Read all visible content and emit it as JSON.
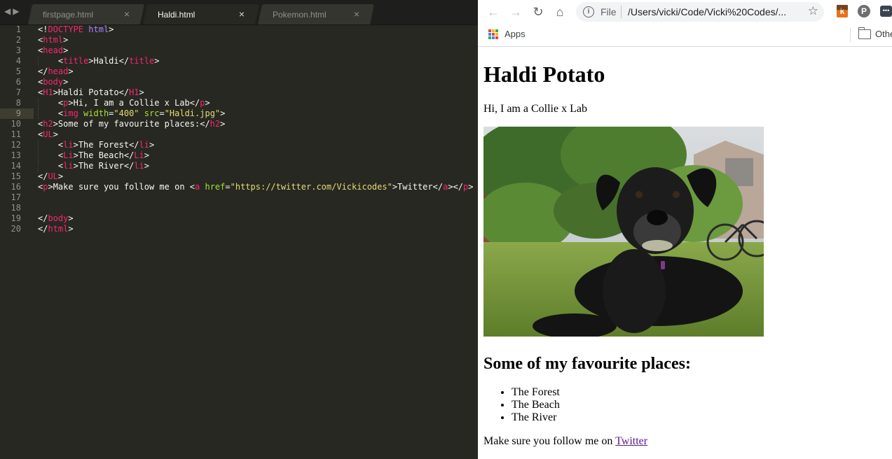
{
  "editor": {
    "tabs": [
      {
        "label": "firstpage.html",
        "active": false
      },
      {
        "label": "Haldi.html",
        "active": true
      },
      {
        "label": "Pokemon.html",
        "active": false
      }
    ],
    "current_line": 9,
    "lines": [
      {
        "n": "1"
      },
      {
        "n": "2"
      },
      {
        "n": "3"
      },
      {
        "n": "4"
      },
      {
        "n": "5"
      },
      {
        "n": "6"
      },
      {
        "n": "7"
      },
      {
        "n": "8"
      },
      {
        "n": "9"
      },
      {
        "n": "10"
      },
      {
        "n": "11"
      },
      {
        "n": "12"
      },
      {
        "n": "13"
      },
      {
        "n": "14"
      },
      {
        "n": "15"
      },
      {
        "n": "16"
      },
      {
        "n": "17"
      },
      {
        "n": "18"
      },
      {
        "n": "19"
      },
      {
        "n": "20"
      }
    ],
    "code": {
      "l1": {
        "doctype": "DOCTYPE",
        "html": "html"
      },
      "l2": "html",
      "l3": "head",
      "l4": {
        "tag": "title",
        "text": "Haldi"
      },
      "l5": "head",
      "l6": "body",
      "l7": {
        "tag": "H1",
        "text": "Haldi Potato"
      },
      "l8": {
        "tag": "p",
        "text": "Hi, I am a Collie x Lab"
      },
      "l9": {
        "tag": "img",
        "attr1": "width",
        "val1": "\"400\"",
        "attr2": "src",
        "val2": "\"Haldi.jpg\""
      },
      "l10": {
        "tag": "h2",
        "text": "Some of my favourite places:"
      },
      "l11": "UL",
      "l12": {
        "tag": "li",
        "text": "The Forest"
      },
      "l13": {
        "tag": "Li",
        "text": "The Beach"
      },
      "l14": {
        "tag": "li",
        "text": "The River"
      },
      "l15": "UL",
      "l16": {
        "tag": "p",
        "text": "Make sure you follow me on ",
        "a": "a",
        "attr": "href",
        "val": "\"https://twitter.com/Vickicodes\"",
        "link": "Twitter"
      },
      "l19": "body",
      "l20": "html"
    }
  },
  "browser": {
    "scheme": "File",
    "url": "/Users/vicki/Code/Vicki%20Codes/...",
    "bookmarks": {
      "apps": "Apps",
      "other": "Othe"
    },
    "extensions": {
      "k": "k",
      "p": "P",
      "m": "•••"
    },
    "page": {
      "h1": "Haldi Potato",
      "intro": "Hi, I am a Collie x Lab",
      "h2": "Some of my favourite places:",
      "places": [
        "The Forest",
        "The Beach",
        "The River"
      ],
      "follow_text": "Make sure you follow me on ",
      "follow_link": "Twitter"
    }
  },
  "colors": {
    "editor_bg": "#272822",
    "tag": "#f92672",
    "attr": "#a6e22e",
    "string": "#e6db74",
    "keyword": "#ae81ff",
    "visited_link": "#551a8b"
  },
  "icons": [
    "back-icon",
    "forward-icon",
    "reload-icon",
    "home-icon",
    "info-icon",
    "star-icon",
    "apps-icon",
    "folder-icon",
    "close-icon",
    "dog-photo"
  ]
}
